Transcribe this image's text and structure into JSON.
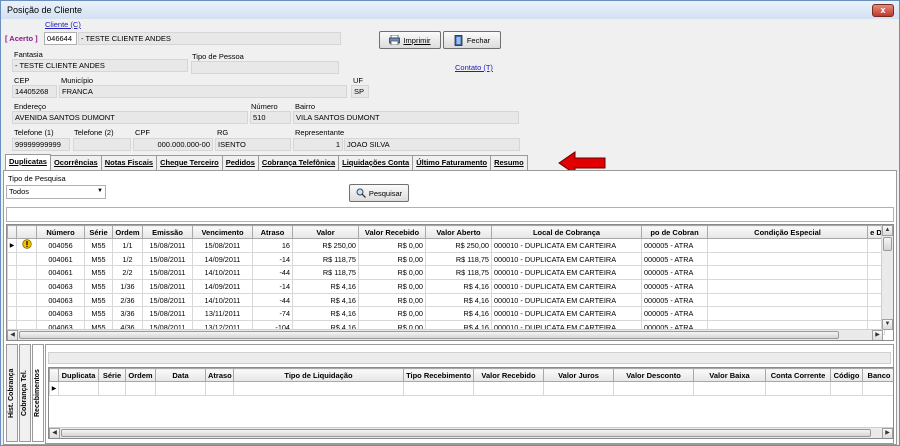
{
  "window": {
    "title": "Posição de Cliente",
    "close_label": "x"
  },
  "header": {
    "acerto_label": "[ Acerto ]",
    "cliente_link": "Cliente (C)",
    "cliente_code": "046644",
    "cliente_name": "- TESTE CLIENTE ANDES",
    "fantasia_label": "Fantasia",
    "fantasia_value": "- TESTE CLIENTE ANDES",
    "tipo_pessoa_label": "Tipo de Pessoa",
    "tipo_pessoa_value": "",
    "cep_label": "CEP",
    "cep_value": "14405268",
    "municipio_label": "Município",
    "municipio_value": "FRANCA",
    "uf_label": "UF",
    "uf_value": "SP",
    "endereco_label": "Endereço",
    "endereco_value": "AVENIDA SANTOS DUMONT",
    "numero_label": "Número",
    "numero_value": "510",
    "bairro_label": "Bairro",
    "bairro_value": "VILA SANTOS DUMONT",
    "telefone1_label": "Telefone (1)",
    "telefone1_value": "99999999999",
    "telefone2_label": "Telefone (2)",
    "telefone2_value": "",
    "cpf_label": "CPF",
    "cpf_value": "000.000.000-00",
    "rg_label": "RG",
    "rg_value": "ISENTO",
    "representante_label": "Representante",
    "representante_code": "1",
    "representante_name": "JOAO SILVA",
    "imprimir_label": "Imprimir",
    "fechar_label": "Fechar",
    "contato_link": "Contato (T)"
  },
  "tabs": [
    {
      "label": "Duplicatas",
      "active": true
    },
    {
      "label": "Ocorrências"
    },
    {
      "label": "Notas Fiscais"
    },
    {
      "label": "Cheque Terceiro"
    },
    {
      "label": "Pedidos"
    },
    {
      "label": "Cobrança Telefônica"
    },
    {
      "label": "Liquidações Conta"
    },
    {
      "label": "Último Faturamento"
    },
    {
      "label": "Resumo"
    }
  ],
  "arrow_color": "#e00000",
  "filter": {
    "tipo_label": "Tipo de Pesquisa",
    "tipo_value": "Todos",
    "pesquisar_label": "Pesquisar"
  },
  "grid1": {
    "columns": [
      "Número",
      "Série",
      "Ordem",
      "Emissão",
      "Vencimento",
      "Atraso",
      "Valor",
      "Valor Recebido",
      "Valor Aberto",
      "Local de Cobrança",
      "po de Cobran",
      "Condição Especial",
      "e D"
    ],
    "rows": [
      [
        "004056",
        "M55",
        "1/1",
        "15/08/2011",
        "15/08/2011",
        "16",
        "R$ 250,00",
        "R$ 0,00",
        "R$ 250,00",
        "000010 - DUPLICATA EM CARTEIRA",
        "000005 - ATRA",
        ""
      ],
      [
        "004061",
        "M55",
        "1/2",
        "15/08/2011",
        "14/09/2011",
        "-14",
        "R$ 118,75",
        "R$ 0,00",
        "R$ 118,75",
        "000010 - DUPLICATA EM CARTEIRA",
        "000005 - ATRA",
        ""
      ],
      [
        "004061",
        "M55",
        "2/2",
        "15/08/2011",
        "14/10/2011",
        "-44",
        "R$ 118,75",
        "R$ 0,00",
        "R$ 118,75",
        "000010 - DUPLICATA EM CARTEIRA",
        "000005 - ATRA",
        ""
      ],
      [
        "004063",
        "M55",
        "1/36",
        "15/08/2011",
        "14/09/2011",
        "-14",
        "R$ 4,16",
        "R$ 0,00",
        "R$ 4,16",
        "000010 - DUPLICATA EM CARTEIRA",
        "000005 - ATRA",
        ""
      ],
      [
        "004063",
        "M55",
        "2/36",
        "15/08/2011",
        "14/10/2011",
        "-44",
        "R$ 4,16",
        "R$ 0,00",
        "R$ 4,16",
        "000010 - DUPLICATA EM CARTEIRA",
        "000005 - ATRA",
        ""
      ],
      [
        "004063",
        "M55",
        "3/36",
        "15/08/2011",
        "13/11/2011",
        "-74",
        "R$ 4,16",
        "R$ 0,00",
        "R$ 4,16",
        "000010 - DUPLICATA EM CARTEIRA",
        "000005 - ATRA",
        ""
      ],
      [
        "004063",
        "M55",
        "4/36",
        "15/08/2011",
        "13/12/2011",
        "-104",
        "R$ 4,16",
        "R$ 0,00",
        "R$ 4,16",
        "000010 - DUPLICATA EM CARTEIRA",
        "000005 - ATRA",
        ""
      ]
    ]
  },
  "side_tabs": [
    "Hist. Cobrança",
    "Cobrança Tel.",
    "Recebimentos"
  ],
  "grid2": {
    "columns": [
      "Duplicata",
      "Série",
      "Ordem",
      "Data",
      "Atraso",
      "Tipo de Liquidação",
      "Tipo Recebimento",
      "Valor Recebido",
      "Valor Juros",
      "Valor Desconto",
      "Valor Baixa",
      "Conta Corrente",
      "Código",
      "Banco"
    ]
  }
}
